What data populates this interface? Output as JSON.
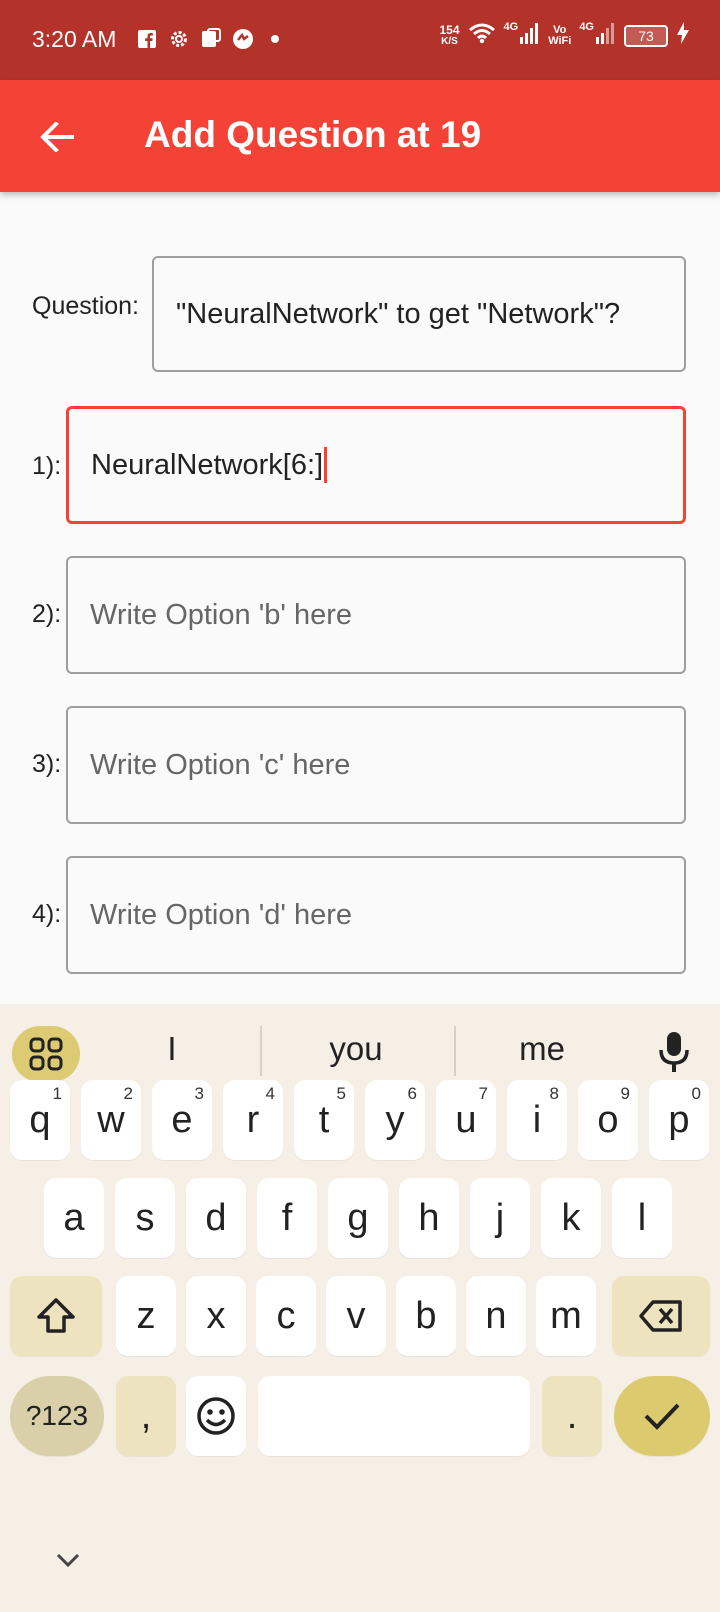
{
  "status_bar": {
    "time": "3:20 AM",
    "net_speed_value": "154",
    "net_speed_unit": "K/S",
    "net1": "4G",
    "volte_1": "Vo",
    "volte_2": "WiFi",
    "net2": "4G",
    "battery": "73",
    "icons": [
      "facebook-icon",
      "settings-icon",
      "notification-icon",
      "app-icon",
      "dot-icon",
      "wifi-icon",
      "signal-icon",
      "signal-icon",
      "battery-icon",
      "charging-icon"
    ]
  },
  "app_bar": {
    "title": "Add Question at 19",
    "back_icon": "arrow-left-icon"
  },
  "form": {
    "question_label": "Question:",
    "question_value": "\"NeuralNetwork\" to get \"Network\"?",
    "options": [
      {
        "label": "1):",
        "value": "NeuralNetwork[6:]",
        "placeholder": ""
      },
      {
        "label": "2):",
        "value": "",
        "placeholder": "Write Option 'b' here"
      },
      {
        "label": "3):",
        "value": "",
        "placeholder": "Write Option 'c' here"
      },
      {
        "label": "4):",
        "value": "",
        "placeholder": "Write Option 'd' here"
      }
    ]
  },
  "keyboard": {
    "suggestions": [
      "I",
      "you",
      "me"
    ],
    "row1": [
      {
        "k": "q",
        "h": "1"
      },
      {
        "k": "w",
        "h": "2"
      },
      {
        "k": "e",
        "h": "3"
      },
      {
        "k": "r",
        "h": "4"
      },
      {
        "k": "t",
        "h": "5"
      },
      {
        "k": "y",
        "h": "6"
      },
      {
        "k": "u",
        "h": "7"
      },
      {
        "k": "i",
        "h": "8"
      },
      {
        "k": "o",
        "h": "9"
      },
      {
        "k": "p",
        "h": "0"
      }
    ],
    "row2": [
      "a",
      "s",
      "d",
      "f",
      "g",
      "h",
      "j",
      "k",
      "l"
    ],
    "row3": [
      "z",
      "x",
      "c",
      "v",
      "b",
      "n",
      "m"
    ],
    "sym_label": "?123",
    "comma": ",",
    "period": ".",
    "icons": [
      "grid-icon",
      "mic-icon",
      "shift-icon",
      "backspace-icon",
      "emoji-icon",
      "check-icon",
      "chevron-down-icon"
    ]
  }
}
